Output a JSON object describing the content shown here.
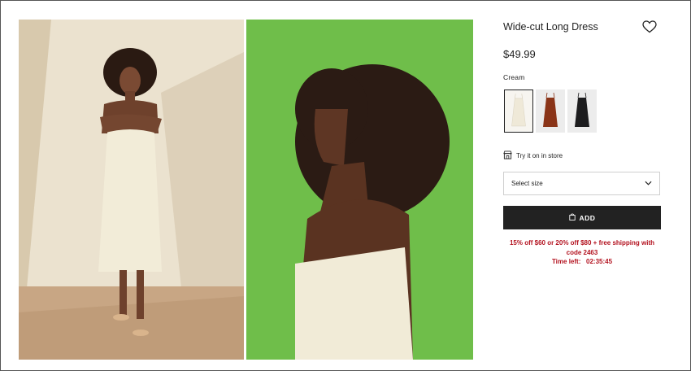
{
  "product": {
    "title": "Wide-cut Long Dress",
    "price": "$49.99",
    "color_label": "Cream",
    "favorite_icon": "heart-icon"
  },
  "swatches": [
    {
      "name": "cream",
      "color": "#efe9d8",
      "selected": true
    },
    {
      "name": "rust",
      "color": "#8a3418",
      "selected": false
    },
    {
      "name": "black",
      "color": "#1c1c1e",
      "selected": false
    }
  ],
  "store": {
    "label": "Try it on in store",
    "icon": "store-icon"
  },
  "size": {
    "placeholder": "Select size",
    "icon": "chevron-down-icon"
  },
  "add_button": {
    "label": "ADD",
    "icon": "shopping-bag-icon"
  },
  "promo": {
    "line1": "15% off $60 or 20% off $80 + free shipping with",
    "line2": "code 2463",
    "timer_label": "Time left:",
    "timer_value": "02:35:45",
    "color": "#b3121f"
  },
  "images": [
    {
      "name": "model-front-photo",
      "bg": "#ece3d2"
    },
    {
      "name": "model-side-photo",
      "bg": "#6fbe4a"
    }
  ]
}
